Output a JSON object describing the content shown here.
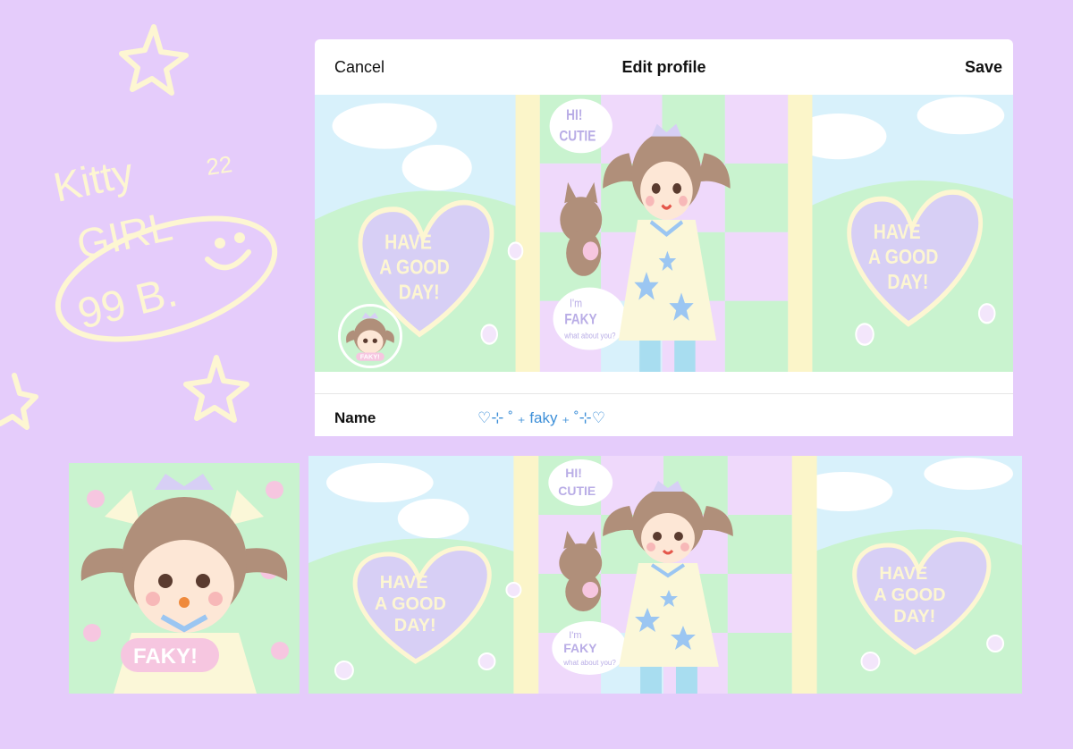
{
  "deco": {
    "doodle_line1": "Kitty",
    "doodle_line2": "GIRL",
    "doodle_line3": "99 B.",
    "doodle_number": "22"
  },
  "editor": {
    "cancel_label": "Cancel",
    "title": "Edit profile",
    "save_label": "Save",
    "name_label": "Name",
    "name_value": "♡⊹ ˚ ₊ faky ₊ ˚⊹♡"
  },
  "art": {
    "heart_text_1": "HAVE",
    "heart_text_2": "A GOOD",
    "heart_text_3": "DAY!",
    "bubble_top_1": "HI!",
    "bubble_top_2": "CUTIE",
    "bubble_bottom_1": "I'm",
    "bubble_bottom_2": "FAKY",
    "bubble_bottom_3": "what about you?",
    "avatar_tag": "FAKY!"
  },
  "colors": {
    "background": "#e5ccfb",
    "doodle": "#fdf6d2",
    "sky": "#d8f1fb",
    "grass": "#c9f3cf",
    "heart": "#d7cff5",
    "link_blue": "#3d8fd8"
  }
}
